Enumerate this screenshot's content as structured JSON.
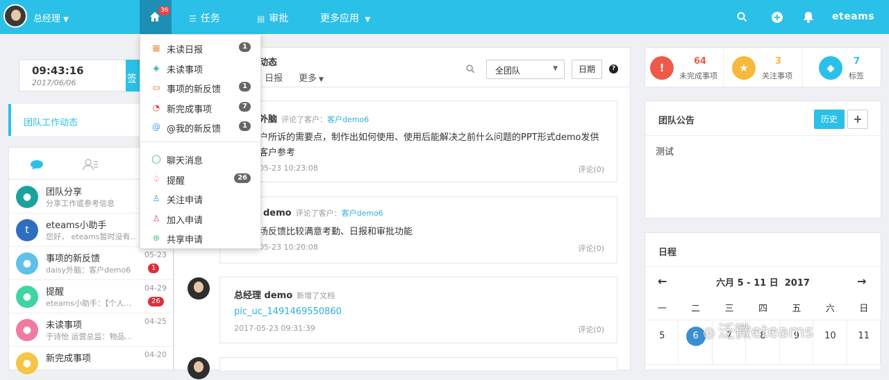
{
  "topbar": {
    "user_name": "总经理",
    "home_badge": "36",
    "nav": [
      {
        "label": "任务",
        "icon": "list-icon"
      },
      {
        "label": "审批",
        "icon": "doc-icon"
      },
      {
        "label": "更多应用",
        "icon": "chevron-down-icon"
      }
    ],
    "brand": "eteams",
    "bg_color": "#2bc0e8"
  },
  "dropdown": {
    "items": [
      {
        "label": "未读日报",
        "badge": "1",
        "icon": "calendar-icon"
      },
      {
        "label": "未读事项",
        "badge": "",
        "icon": "layers-icon"
      },
      {
        "label": "事项的新反馈",
        "badge": "1",
        "icon": "comment-icon"
      },
      {
        "label": "新完成事项",
        "badge": "7",
        "icon": "clock-icon"
      },
      {
        "label": "@我的新反馈",
        "badge": "1",
        "icon": "at-icon"
      },
      {
        "label": "聊天消息",
        "badge": "",
        "icon": "chat-icon"
      },
      {
        "label": "提醒",
        "badge": "26",
        "icon": "bell-icon"
      },
      {
        "label": "关注申请",
        "badge": "",
        "icon": "user-icon"
      },
      {
        "label": "加入申请",
        "badge": "",
        "icon": "user-add-icon"
      },
      {
        "label": "共享申请",
        "badge": "",
        "icon": "share-icon"
      }
    ]
  },
  "left": {
    "time": "09:43:16",
    "date": "2017/06/06",
    "checkin_label": "签",
    "team_dynamic": "团队工作动态",
    "messages": [
      {
        "title": "团队分享",
        "sub": "分享工作或参考信息",
        "date": "",
        "badge": "",
        "color": "#1aa39a",
        "icon": "team-icon"
      },
      {
        "title": "eteams小助手",
        "sub": "您好， eteams暂时没有...",
        "date": "",
        "badge": "",
        "color": "#2e6ec0",
        "icon": "assistant-icon"
      },
      {
        "title": "事项的新反馈",
        "sub": "daisy外脑：客户demo6",
        "date": "05-23",
        "badge": "1",
        "color": "#5fc1ea",
        "icon": "comment-icon"
      },
      {
        "title": "提醒",
        "sub": "eteams小助手：【个人...",
        "date": "04-29",
        "badge": "26",
        "color": "#3fd4a0",
        "icon": "bell-icon"
      },
      {
        "title": "未读事项",
        "sub": "于诗怡 运营总监：物品...",
        "date": "04-25",
        "badge": "",
        "color": "#f07aa0",
        "icon": "layers-icon"
      },
      {
        "title": "新完成事项",
        "sub": "",
        "date": "04-20",
        "badge": "",
        "color": "#f6c545",
        "icon": "clock-icon"
      }
    ]
  },
  "center": {
    "title": "动态",
    "tabs": [
      "日报",
      "更多"
    ],
    "team_select": "全团队",
    "date_button": "日期",
    "help": "?",
    "feeds": [
      {
        "name": "外脑",
        "action": "评论了客户：",
        "link": "客户demo6",
        "body": "户所诉的需要点，制作出如何使用、使用后能解决之前什么问题的PPT形式demo发供客户参考",
        "time": "05-23 10:23:08",
        "comment": "评论(0)"
      },
      {
        "name": "demo",
        "action": "评论了客户：",
        "link": "客户demo6",
        "body": "场反馈比较满意考勤、日报和审批功能",
        "time": "05-23 10:20:08",
        "comment": "评论(0)"
      },
      {
        "name": "总经理 demo",
        "action": "新增了文档",
        "link": "",
        "body": "pic_uc_1491469550860",
        "time": "2017-05-23 09:31:39",
        "comment": "评论(0)"
      }
    ]
  },
  "right": {
    "stats": [
      {
        "value": "64",
        "label": "未完成事项",
        "color": "#ee5a4a",
        "value_color": "#ee5a4a",
        "symbol": "!",
        "icon": "alert-icon"
      },
      {
        "value": "3",
        "label": "关注事项",
        "color": "#f6b93b",
        "value_color": "#f6b93b",
        "symbol": "★",
        "icon": "star-icon"
      },
      {
        "value": "7",
        "label": "标签",
        "color": "#2bc0e8",
        "value_color": "#2bc0e8",
        "symbol": "⬥",
        "icon": "tag-icon"
      }
    ],
    "notice": {
      "title": "团队公告",
      "history": "历史",
      "add": "+",
      "content": "测试"
    },
    "schedule": {
      "title": "日程",
      "range": "六月 5 - 11 日  2017",
      "weekdays": [
        "一",
        "二",
        "三",
        "四",
        "五",
        "六",
        "日"
      ],
      "days": [
        "5",
        "6",
        "7",
        "8",
        "9",
        "10",
        "11"
      ],
      "today_index": 1
    }
  },
  "watermark": "泛微eteams"
}
